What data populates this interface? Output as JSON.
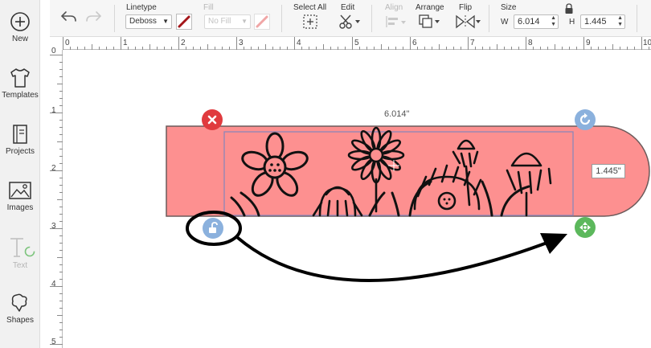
{
  "sidebar": {
    "items": [
      {
        "label": "New",
        "icon": "plus-circle-icon"
      },
      {
        "label": "Templates",
        "icon": "tshirt-icon"
      },
      {
        "label": "Projects",
        "icon": "notebook-icon"
      },
      {
        "label": "Images",
        "icon": "image-icon"
      },
      {
        "label": "Text",
        "icon": "text-icon"
      },
      {
        "label": "Shapes",
        "icon": "shapes-icon"
      }
    ]
  },
  "toolbar": {
    "linetype_label": "Linetype",
    "linetype_value": "Deboss",
    "fill_label": "Fill",
    "fill_value": "No Fill",
    "select_all_label": "Select All",
    "edit_label": "Edit",
    "align_label": "Align",
    "arrange_label": "Arrange",
    "flip_label": "Flip",
    "size_label": "Size",
    "w_label": "W",
    "w_value": "6.014",
    "h_label": "H",
    "h_value": "1.445"
  },
  "ruler": {
    "top": [
      "0",
      "1",
      "2",
      "3",
      "4",
      "5",
      "6",
      "7",
      "8",
      "9",
      "10"
    ],
    "left": [
      "0",
      "1",
      "2",
      "3",
      "4",
      "5"
    ]
  },
  "canvas": {
    "width_readout": "6.014\"",
    "height_readout": "1.445\""
  },
  "colors": {
    "shape_fill": "#fd9090",
    "delete_handle": "#e03a3e",
    "rotate_handle": "#8bb1dd",
    "resize_handle": "#5cb85c",
    "lock_handle": "#8bb1dd"
  }
}
